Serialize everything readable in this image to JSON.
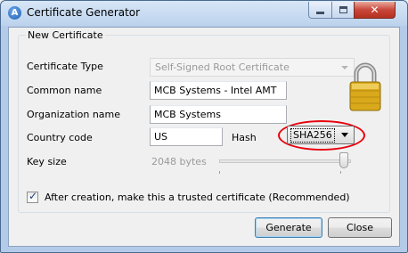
{
  "window": {
    "title": "Certificate Generator",
    "icon": "app-logo-icon"
  },
  "titlebar_buttons": {
    "minimize": "minimize-icon",
    "maximize": "maximize-icon",
    "close_glyph": "✕"
  },
  "group": {
    "legend": "New Certificate"
  },
  "form": {
    "certificate_type": {
      "label": "Certificate Type",
      "value": "Self-Signed Root Certificate",
      "enabled": false
    },
    "common_name": {
      "label": "Common name",
      "value": "MCB Systems - Intel AMT"
    },
    "organization_name": {
      "label": "Organization name",
      "value": "MCB Systems"
    },
    "country_code": {
      "label": "Country code",
      "value": "US"
    },
    "hash": {
      "label": "Hash",
      "value": "SHA256"
    },
    "key_size": {
      "label": "Key size",
      "value_text": "2048 bytes",
      "slider_level": 1.0
    },
    "trusted": {
      "label": "After creation, make this a trusted certificate (Recommended)",
      "checked": true
    }
  },
  "buttons": {
    "generate": "Generate",
    "close": "Close"
  },
  "colors": {
    "highlight_circle": "#e8000d",
    "close_button": "#c9473a"
  }
}
